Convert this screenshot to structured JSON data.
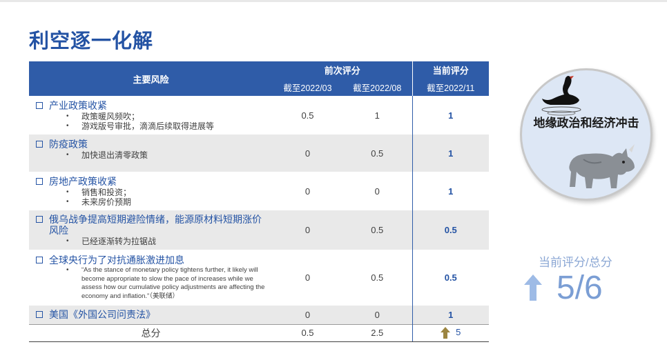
{
  "page": {
    "title": "利空逐一化解"
  },
  "table": {
    "headers": {
      "main_risk": "主要风险",
      "prev_score": "前次评分",
      "curr_score": "当前评分",
      "date_0303": "截至2022/03",
      "date_0308": "截至2022/08",
      "date_2211": "截至2022/11"
    },
    "rows": [
      {
        "risk": "产业政策收紧",
        "subs": [
          "政策暖风频吹；",
          "游戏版号审批，滴滴后续取得进展等"
        ],
        "s1": "0.5",
        "s2": "1",
        "s3": "1"
      },
      {
        "risk": "防疫政策",
        "subs": [
          "加快退出清零政策"
        ],
        "s1": "0",
        "s2": "0.5",
        "s3": "1"
      },
      {
        "risk": "房地产政策收紧",
        "subs": [
          "销售和投资；",
          "未来房价预期"
        ],
        "s1": "0",
        "s2": "0",
        "s3": "1"
      },
      {
        "risk": "俄乌战争提高短期避险情绪，能源原材料短期涨价风险",
        "subs": [
          "已经逐渐转为拉锯战"
        ],
        "s1": "0",
        "s2": "0.5",
        "s3": "0.5"
      },
      {
        "risk": "全球央行为了对抗通胀激进加息",
        "subs": [
          "“As the stance of monetary policy tightens further, it likely will become appropriate to slow the pace of increases while we assess how our cumulative policy adjustments are affecting the economy and inflation.”（美联储）"
        ],
        "s1": "0",
        "s2": "0.5",
        "s3": "0.5"
      },
      {
        "risk": "美国《外国公司问责法》",
        "subs": [],
        "s1": "0",
        "s2": "0",
        "s3": "1"
      }
    ],
    "total": {
      "label": "总分",
      "s1": "0.5",
      "s2": "2.5",
      "s3": "5"
    }
  },
  "side": {
    "circle_text": "地缘政治和经济冲击",
    "score_label": "当前评分/总分",
    "score_value": "5/6"
  },
  "colors": {
    "accent": "#2453a4",
    "header_bg": "#2f5ca8",
    "score_light": "#7b9ed4",
    "arrow_gold": "#9c8540"
  }
}
